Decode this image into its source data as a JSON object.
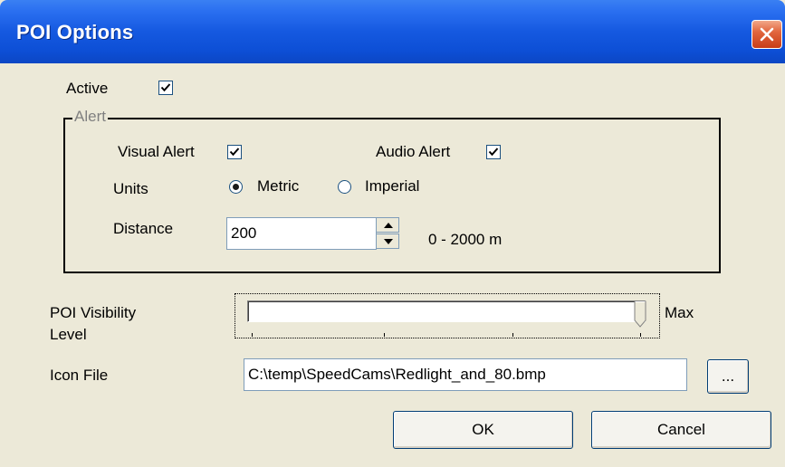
{
  "window": {
    "title": "POI Options"
  },
  "active": {
    "label": "Active",
    "checked": true
  },
  "alert_group": {
    "legend": "Alert",
    "visual_alert": {
      "label": "Visual Alert",
      "checked": true
    },
    "audio_alert": {
      "label": "Audio Alert",
      "checked": true
    },
    "units": {
      "label": "Units",
      "options": [
        {
          "label": "Metric",
          "selected": true
        },
        {
          "label": "Imperial",
          "selected": false
        }
      ]
    },
    "distance": {
      "label": "Distance",
      "value": "200",
      "range_text": "0 - 2000 m"
    }
  },
  "visibility": {
    "label_line1": "POI Visibility",
    "label_line2": "Level",
    "max_label": "Max",
    "level_fraction": 1.0
  },
  "icon_file": {
    "label": "Icon File",
    "value": "C:\\temp\\SpeedCams\\Redlight_and_80.bmp",
    "browse_label": "..."
  },
  "buttons": {
    "ok": "OK",
    "cancel": "Cancel"
  },
  "colors": {
    "title_bar": "#1559e0",
    "close_button": "#e2673f",
    "dialog_bg": "#ece9d8"
  },
  "icons": {
    "close": "close-icon",
    "check": "check-icon",
    "spin_up": "arrow-up-icon",
    "spin_down": "arrow-down-icon"
  }
}
